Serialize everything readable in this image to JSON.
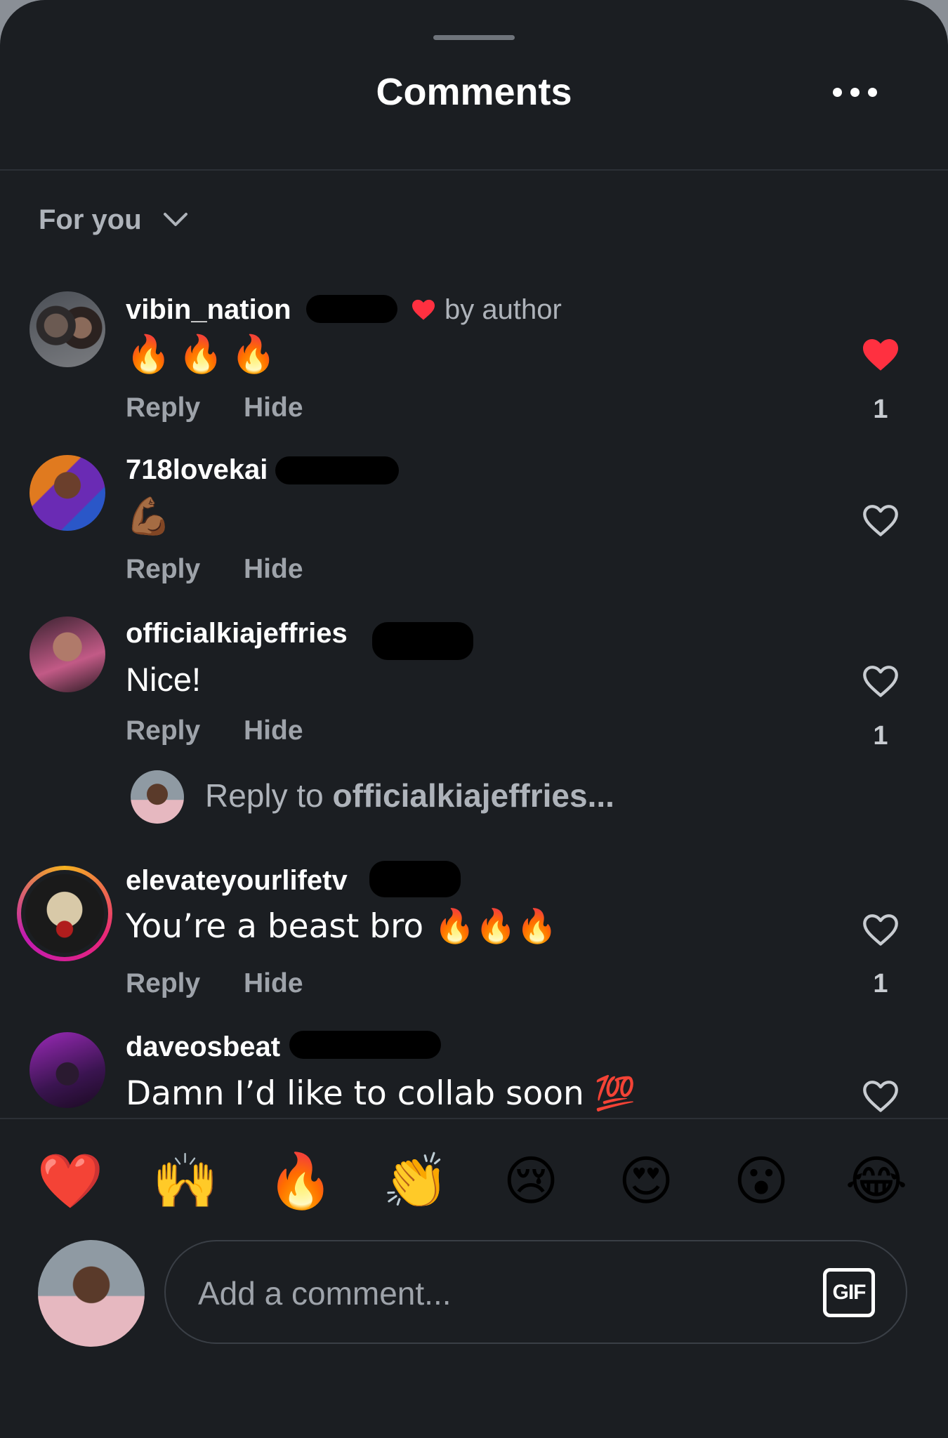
{
  "header": {
    "title": "Comments",
    "more_icon": "more-horizontal-icon"
  },
  "filter": {
    "label": "For you",
    "icon": "chevron-down-icon"
  },
  "colors": {
    "background": "#1b1e22",
    "liked": "#ff3040",
    "muted_text": "#9ea3aa",
    "text": "#ffffff"
  },
  "comments": [
    {
      "username": "vibin_nation",
      "badge": "by author",
      "text": "🔥🔥🔥",
      "reply": "Reply",
      "hide": "Hide",
      "likes": "1",
      "liked": true
    },
    {
      "username": "718lovekai",
      "text": "💪🏾",
      "reply": "Reply",
      "hide": "Hide",
      "likes": "",
      "liked": false
    },
    {
      "username": "officialkiajeffries",
      "text": "Nice!",
      "reply": "Reply",
      "hide": "Hide",
      "likes": "1",
      "liked": false
    },
    {
      "username": "elevateyourlifetv",
      "text": "You’re a beast bro 🔥🔥🔥",
      "reply": "Reply",
      "hide": "Hide",
      "likes": "1",
      "liked": false
    },
    {
      "username": "daveosbeat",
      "text": "Damn I’d like to collab soon 💯",
      "liked": false
    }
  ],
  "reply_prompt": {
    "prefix": "Reply to ",
    "target": "officialkiajeffries..."
  },
  "reactions": [
    "❤️",
    "🙌",
    "🔥",
    "👏",
    "😢",
    "😍",
    "😮",
    "😂"
  ],
  "composer": {
    "placeholder": "Add a comment...",
    "gif_label": "GIF"
  }
}
